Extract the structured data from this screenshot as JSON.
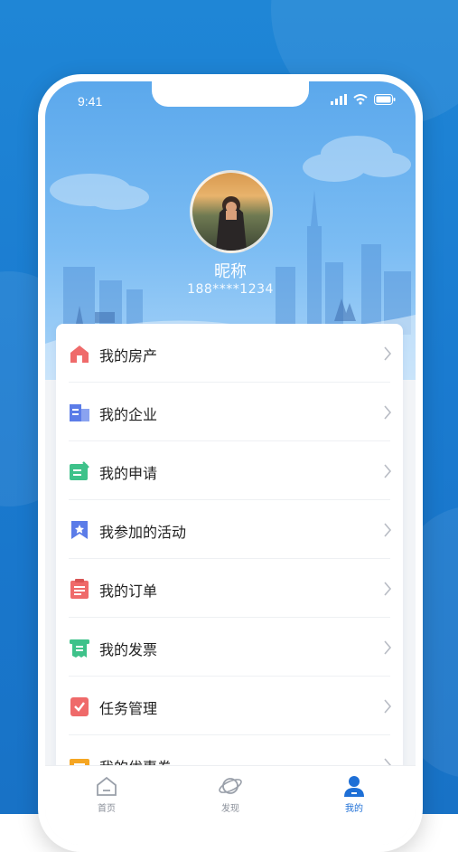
{
  "status_bar": {
    "time": "9:41"
  },
  "profile": {
    "nickname": "昵称",
    "phone": "188****1234"
  },
  "menu": {
    "items": [
      {
        "label": "我的房产",
        "icon": "house-icon",
        "color": "#ef6a6a"
      },
      {
        "label": "我的企业",
        "icon": "building-icon",
        "color": "#5b7ce8"
      },
      {
        "label": "我的申请",
        "icon": "application-icon",
        "color": "#3ec28a"
      },
      {
        "label": "我参加的活动",
        "icon": "activity-flag-icon",
        "color": "#5b7ce8"
      },
      {
        "label": "我的订单",
        "icon": "order-clipboard-icon",
        "color": "#ef6a6a"
      },
      {
        "label": "我的发票",
        "icon": "invoice-icon",
        "color": "#3ec28a"
      },
      {
        "label": "任务管理",
        "icon": "task-icon",
        "color": "#ef6a6a"
      },
      {
        "label": "我的优惠券",
        "icon": "coupon-icon",
        "color": "#f5a623"
      }
    ]
  },
  "tabbar": {
    "tabs": [
      {
        "label": "首页",
        "icon": "home-icon"
      },
      {
        "label": "发现",
        "icon": "planet-icon"
      },
      {
        "label": "我的",
        "icon": "user-icon",
        "active": true
      }
    ]
  },
  "colors": {
    "accent": "#1e6fd6",
    "hero": "#5ba8ec",
    "background": "#1a7bd0"
  }
}
